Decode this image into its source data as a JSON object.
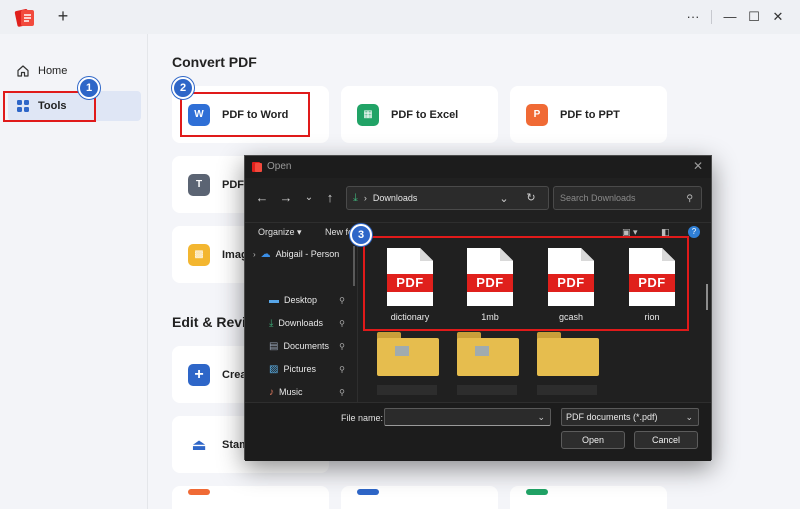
{
  "titlebar": {
    "new_tab": "+",
    "more": "···",
    "minimize": "—",
    "maximize": "☐",
    "close": "✕"
  },
  "sidebar": {
    "items": [
      {
        "label": "Home",
        "icon": "home-icon"
      },
      {
        "label": "Tools",
        "icon": "grid-icon",
        "active": true
      }
    ]
  },
  "main": {
    "convert_title": "Convert PDF",
    "edit_title": "Edit & Revi",
    "cards": {
      "pdf_to_word": "PDF to Word",
      "pdf_to_excel": "PDF to Excel",
      "pdf_to_ppt": "PDF to PPT",
      "pdf_partial": "PDF",
      "image_partial": "Imag",
      "create_partial": "Crea",
      "stamp_partial": "Stam"
    }
  },
  "badges": [
    "1",
    "2",
    "3"
  ],
  "colors": {
    "highlight": "#e01a1a",
    "badge": "#2e66c8",
    "word": "#2f6fd6",
    "excel": "#21a366",
    "ppt": "#f06a35",
    "pdf_red": "#e0201c"
  },
  "dialog": {
    "title": "Open",
    "address": "Downloads",
    "search_placeholder": "Search Downloads",
    "organize": "Organize",
    "new_folder": "New fo",
    "nav": [
      {
        "label": "Abigail - Person",
        "icon": "cloud-icon"
      },
      {
        "label": "Desktop",
        "icon": "desktop-icon"
      },
      {
        "label": "Downloads",
        "icon": "download-icon"
      },
      {
        "label": "Documents",
        "icon": "documents-icon"
      },
      {
        "label": "Pictures",
        "icon": "pictures-icon"
      },
      {
        "label": "Music",
        "icon": "music-icon"
      }
    ],
    "files": [
      {
        "name": "dictionary",
        "badge": "PDF"
      },
      {
        "name": "1mb",
        "badge": "PDF"
      },
      {
        "name": "gcash",
        "badge": "PDF"
      },
      {
        "name": "rion",
        "badge": "PDF"
      }
    ],
    "file_name_label": "File name:",
    "file_name_value": "",
    "file_type": "PDF documents (*.pdf)",
    "open_button": "Open",
    "cancel_button": "Cancel"
  }
}
